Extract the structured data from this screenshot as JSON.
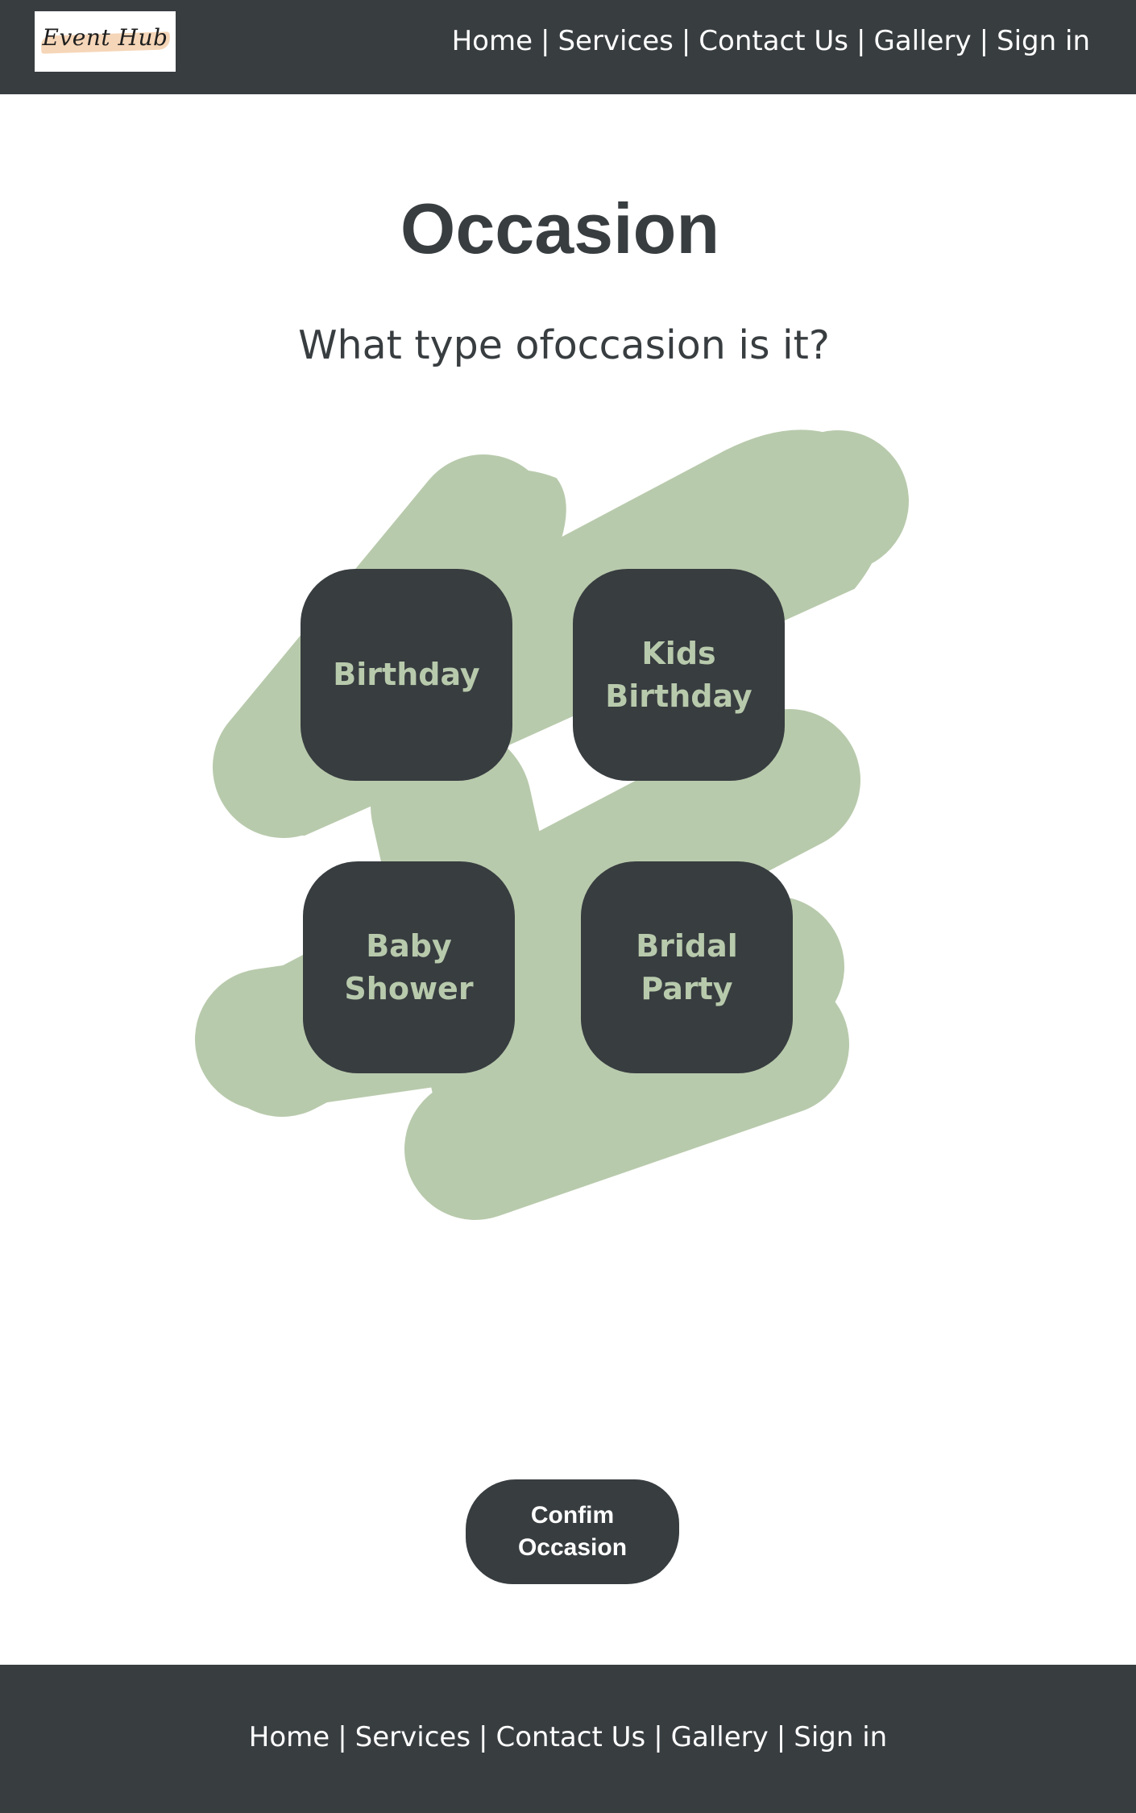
{
  "header": {
    "logo_text": "Event Hub",
    "nav": [
      "Home",
      "Services",
      "Contact Us",
      "Gallery",
      "Sign in"
    ],
    "separator": "|"
  },
  "main": {
    "title": "Occasion",
    "subtitle": "What type ofoccasion is it?",
    "options": [
      "Birthday",
      "Kids Birthday",
      "Baby Shower",
      "Bridal Party"
    ],
    "confirm_label": "Confim Occasion"
  },
  "footer": {
    "nav": [
      "Home",
      "Services",
      "Contact Us",
      "Gallery",
      "Sign in"
    ],
    "separator": "|"
  },
  "colors": {
    "dark": "#383d40",
    "sage": "#b8caac",
    "white": "#ffffff",
    "logo_brush": "#f6d6b8"
  }
}
